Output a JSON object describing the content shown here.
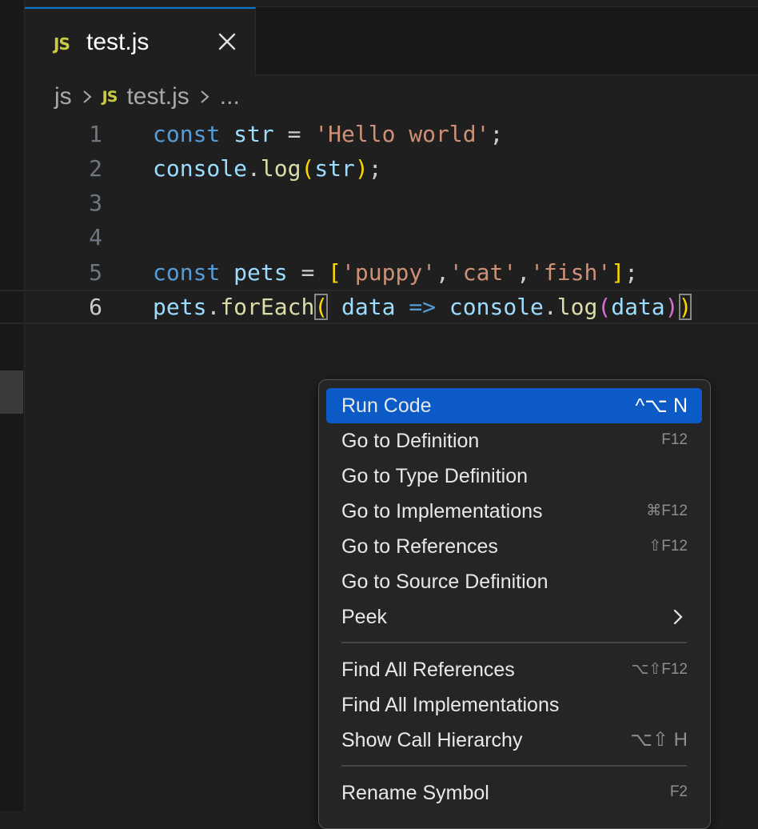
{
  "tab": {
    "badge": "JS",
    "title": "test.js"
  },
  "breadcrumb": {
    "folder": "js",
    "badge": "JS",
    "file": "test.js",
    "more": "..."
  },
  "editor": {
    "lines": [
      {
        "number": "1",
        "code": "const str = 'Hello world';"
      },
      {
        "number": "2",
        "code": "console.log(str);"
      },
      {
        "number": "3",
        "code": ""
      },
      {
        "number": "4",
        "code": ""
      },
      {
        "number": "5",
        "code": "const pets = ['puppy','cat','fish'];"
      },
      {
        "number": "6",
        "code": "pets.forEach( data => console.log(data))"
      }
    ]
  },
  "context_menu": {
    "items": [
      {
        "label": "Run Code",
        "shortcut": "^⌥ N"
      },
      {
        "label": "Go to Definition",
        "shortcut": "F12"
      },
      {
        "label": "Go to Type Definition",
        "shortcut": ""
      },
      {
        "label": "Go to Implementations",
        "shortcut": "⌘F12"
      },
      {
        "label": "Go to References",
        "shortcut": "⇧F12"
      },
      {
        "label": "Go to Source Definition",
        "shortcut": ""
      },
      {
        "label": "Peek",
        "shortcut": ""
      },
      {
        "label": "Find All References",
        "shortcut": "⌥⇧F12"
      },
      {
        "label": "Find All Implementations",
        "shortcut": ""
      },
      {
        "label": "Show Call Hierarchy",
        "shortcut": "⌥⇧ H"
      },
      {
        "label": "Rename Symbol",
        "shortcut": "F2"
      }
    ]
  },
  "colors": {
    "accent": "#0c5ac6",
    "js_badge": "#cbcb41",
    "keyword": "#569cd6",
    "variable": "#9cdcfe",
    "function": "#dcdcaa",
    "string": "#ce9178"
  }
}
